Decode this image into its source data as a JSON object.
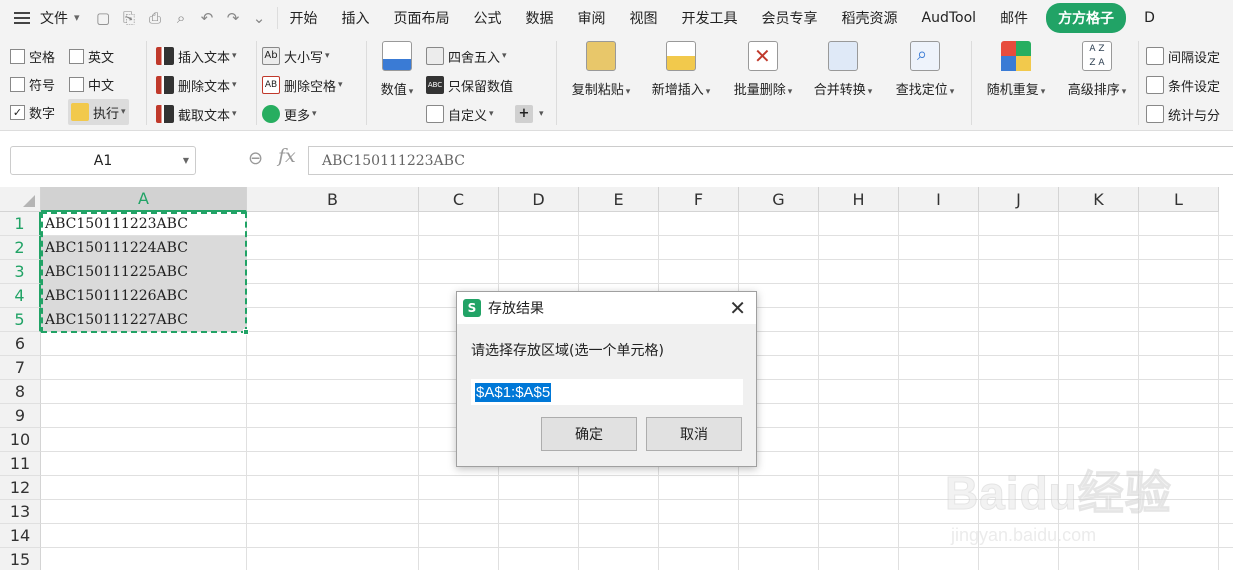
{
  "menubar": {
    "file_label": "文件",
    "tabs": [
      "开始",
      "插入",
      "页面布局",
      "公式",
      "数据",
      "审阅",
      "视图",
      "开发工具",
      "会员专享",
      "稻壳资源",
      "AudTool",
      "邮件"
    ],
    "active_tab": "方方格子",
    "overflow_tab": "D"
  },
  "ribbon": {
    "checkboxes": [
      {
        "label": "空格",
        "checked": ""
      },
      {
        "label": "英文",
        "checked": ""
      },
      {
        "label": "符号",
        "checked": ""
      },
      {
        "label": "中文",
        "checked": ""
      },
      {
        "label": "数字",
        "checked": "✓"
      }
    ],
    "execute_label": "执行",
    "text_tools": [
      "插入文本",
      "删除文本",
      "截取文本"
    ],
    "case_tools": [
      "大小写",
      "删除空格",
      "更多"
    ],
    "value_label": "数值",
    "number_tools": [
      "四舍五入",
      "只保留数值",
      "自定义"
    ],
    "big_buttons": [
      "复制粘贴",
      "新增插入",
      "批量删除",
      "合并转换",
      "查找定位",
      "随机重复",
      "高级排序"
    ],
    "right_tools": [
      "间隔设定",
      "条件设定",
      "统计与分"
    ]
  },
  "formula_bar": {
    "name_box": "A1",
    "fx": "fx",
    "content": "ABC150111223ABC"
  },
  "sheet": {
    "columns": [
      "A",
      "B",
      "C",
      "D",
      "E",
      "F",
      "G",
      "H",
      "I",
      "J",
      "K",
      "L"
    ],
    "rows": [
      "1",
      "2",
      "3",
      "4",
      "5",
      "6",
      "7",
      "8",
      "9",
      "10",
      "11",
      "12",
      "13",
      "14",
      "15"
    ],
    "cells_a": [
      "ABC150111223ABC",
      "ABC150111224ABC",
      "ABC150111225ABC",
      "ABC150111226ABC",
      "ABC150111227ABC"
    ]
  },
  "dialog": {
    "title": "存放结果",
    "logo": "S",
    "prompt": "请选择存放区域(选一个单元格)",
    "input_value": "$A$1:$A$5",
    "ok_label": "确定",
    "cancel_label": "取消",
    "close": "✕"
  },
  "watermark": {
    "brand": "Baidu经验",
    "url": "jingyan.baidu.com"
  },
  "colors": {
    "accent_green": "#21a366",
    "selection_blue": "#0078d7"
  }
}
